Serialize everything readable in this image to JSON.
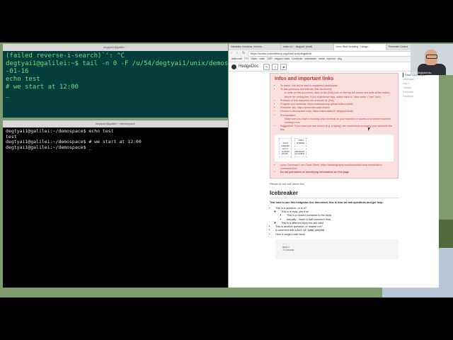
{
  "terminal1": {
    "title": "degtyai1@galilei: ~",
    "lines": [
      "(failed reverse-i-search)`': ^C",
      "degtyai1@galilei:~$ tail -n 0 -F /u/54/degtyai1/unix/demospace/bash",
      "-01-16",
      "echo test",
      "# we start at 12:00",
      "_"
    ]
  },
  "terminal2": {
    "title": "degtyai1@galilei: ~/demospace",
    "lines": [
      "degtyai1@galilei:~/demospace$ echo test",
      "test",
      "degtyai1@galilei:~/demospace$ # we start at 12:00",
      "degtyai1@galilei:~/demospace$ _"
    ]
  },
  "browser": {
    "tabs": [
      "Variables, functions, environ...",
      "index of / - degtyai1 (shell)",
      "Linux Shell Scripting - Hedge...",
      "Presenter Control"
    ],
    "url": "https://notes.coderefinery.org/shell-scripting#edit",
    "bookmarks": [
      "aalto.mail",
      "TTY",
      "Video",
      "radio",
      "GDP",
      "mapper/.radio",
      "Liveclicks",
      "webmaster",
      "serial",
      "exp/mnt",
      "pkg"
    ],
    "app_name": "HedgeDoc"
  },
  "doc": {
    "infos_title": "Infos and important links",
    "infos_items": [
      "To watch: link will be sent to registered participants",
      "To ask questions and interact (this document):",
      "to write on this document, click on the (Edit) icon on the top left corner and write at the bottom, above the ending line. If you experience lags, switch back to \"view mode\" (\"eye\" icon)",
      "Previous of this document are archived at: [link]",
      "Program and materials: https://aaltoscicomp.github.io/linux-shell/",
      "Presenter link: https://presenter.aalto.fi/shell",
      "Lecturer's demospace copy: https://users.aalto.fi/~degtyai1/shell/",
      "Prerequisites:",
      "Make sure you have a working Linux terminal on your machine or access to a remote machine running Linux",
      "Suggestion: if you have just one screen (e.g. a laptop), we recommend arranging your windows like this:",
      "Linux Command Line Cheat Sheet: https://cheatography.com/davechild/cheat-sheets/linux-command-line/",
      "Do not put names or identifying information on this page"
    ],
    "diagram": "+--------+  +--------+\n|        |  |  SHELL |\n|  ZOOM  |  | WINDOW |\n| WINDOW |  +--------+\n|  WITH  |  +--------+\n| SCREEN |  |BROWSER |\n| SHARE  |  |W/QUEUE |\n+--------+  +--------+",
    "note": "Please do not edit above this",
    "icebreaker_title": "Icebreaker",
    "icebreaker_lead": "Test how to use this hedgedoc live document, this is how we ask questions and get help.",
    "q1": "This is a question, or is it?",
    "q1_reply": "This is a reply, yes it is!",
    "q1_nested": "This is a nested comment to the reply",
    "q1_nested2": "Actually... insert a half comment here",
    "q1_reply2": "This is a different reply but still valid",
    "q2": "This is another question, or maybe not?",
    "q3_prefix": "A comment with a",
    "q3_code": "bit of some pasted",
    "q4": "Here a longer code block",
    "codeblock": "  ...\n  mkdir\n  filename"
  },
  "toc": [
    "Linux Shell Scripti...",
    "Icebreaker",
    "Day 1",
    "Tutorial",
    "Exercises",
    "Feedback"
  ],
  "webcam": {
    "label": "Ivan Degtyarenko"
  }
}
